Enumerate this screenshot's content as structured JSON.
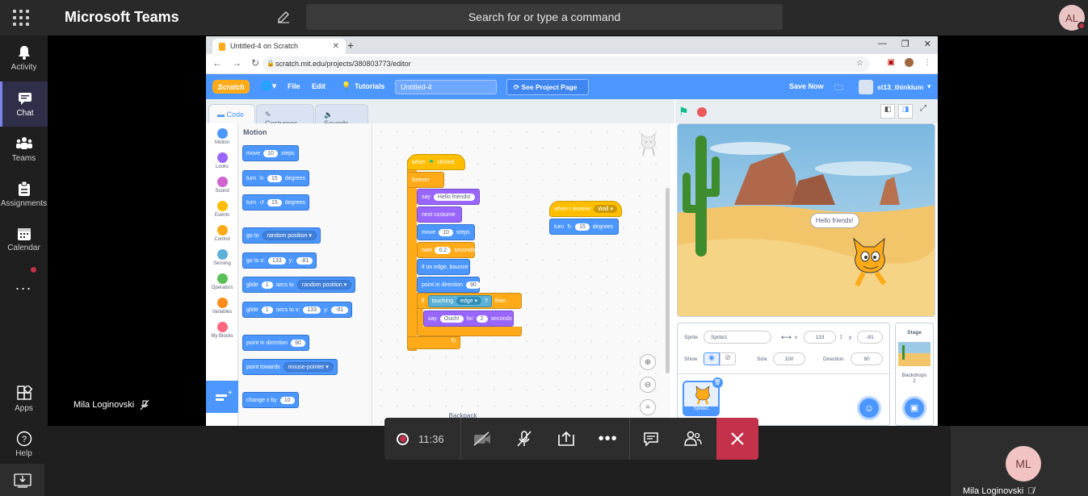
{
  "teams": {
    "app_title": "Microsoft Teams",
    "search_placeholder": "Search for or type a command",
    "user_initials": "AL",
    "rail": [
      {
        "label": "Activity"
      },
      {
        "label": "Chat"
      },
      {
        "label": "Teams"
      },
      {
        "label": "Assignments"
      },
      {
        "label": "Calendar"
      },
      {
        "label": "..."
      },
      {
        "label": "Apps"
      },
      {
        "label": "Help"
      }
    ],
    "presenter_name": "Mila Loginovski",
    "timer": "11:36",
    "self_initials": "ML",
    "self_name": "Mila Loginovski"
  },
  "browser": {
    "tab_title": "Untitled-4 on Scratch",
    "url": "scratch.mit.edu/projects/380803773/editor"
  },
  "scratch": {
    "menu": {
      "logo": "Scratch",
      "file": "File",
      "edit": "Edit",
      "tutorials": "Tutorials",
      "project_title": "Untitled-4",
      "see_project": "See Project Page",
      "save_now": "Save Now",
      "username": "st13_thinklum"
    },
    "tabs": {
      "code": "Code",
      "costumes": "Costumes",
      "sounds": "Sounds"
    },
    "categories": [
      {
        "label": "Motion",
        "color": "#4c97ff"
      },
      {
        "label": "Looks",
        "color": "#9966ff"
      },
      {
        "label": "Sound",
        "color": "#cf63cf"
      },
      {
        "label": "Events",
        "color": "#ffbf00"
      },
      {
        "label": "Control",
        "color": "#ffab19"
      },
      {
        "label": "Sensing",
        "color": "#5cb1d6"
      },
      {
        "label": "Operators",
        "color": "#59c059"
      },
      {
        "label": "Variables",
        "color": "#ff8c1a"
      },
      {
        "label": "My Blocks",
        "color": "#ff6680"
      }
    ],
    "palette_title": "Motion",
    "palette": {
      "move": "move",
      "move_val": "10",
      "steps": "steps",
      "turn": "turn",
      "turn_val": "15",
      "degrees": "degrees",
      "goto": "go to",
      "random_position": "random position",
      "gotoxy": "go to x:",
      "x_val": "133",
      "y_label": "y:",
      "y_val": "-81",
      "glide": "glide",
      "glide_val": "1",
      "secs_to": "secs to",
      "secs_to_x": "secs to x:",
      "point_dir": "point in direction",
      "dir_val": "90",
      "point_towards": "point towards",
      "mouse_pointer": "mouse-pointer",
      "change_x": "change x by",
      "change_x_val": "10"
    },
    "script": {
      "when_flag": "when",
      "clicked": "clicked",
      "forever": "forever",
      "say": "say",
      "hello": "Hello friends!",
      "next_costume": "next costume",
      "move": "move",
      "move_val": "10",
      "steps": "steps",
      "wait": "wait",
      "wait_val": "0.2",
      "seconds": "seconds",
      "bounce": "if on edge, bounce",
      "point_dir": "point in direction",
      "dir_val": "90",
      "if": "if",
      "touching": "touching",
      "edge": "edge",
      "q": "?",
      "then": "then",
      "say2": "say",
      "ouch": "Ouch!",
      "for": "for",
      "for_val": "2",
      "seconds2": "seconds",
      "when_receive": "when I receive",
      "wall": "Wall",
      "turn": "turn",
      "turn_val": "15",
      "degrees": "degrees"
    },
    "stage_bubble": "Hello friends!",
    "sprite_info": {
      "sprite_label": "Sprite",
      "sprite_name": "Sprite1",
      "x_label": "x",
      "x": "133",
      "y_label": "y",
      "y": "-81",
      "show_label": "Show",
      "size_label": "Size",
      "size": "100",
      "direction_label": "Direction",
      "direction": "90",
      "thumb_label": "Sprite1"
    },
    "stage_panel": {
      "title": "Stage",
      "backdrops_label": "Backdrops",
      "backdrops_count": "2"
    },
    "backpack": "Backpack"
  }
}
